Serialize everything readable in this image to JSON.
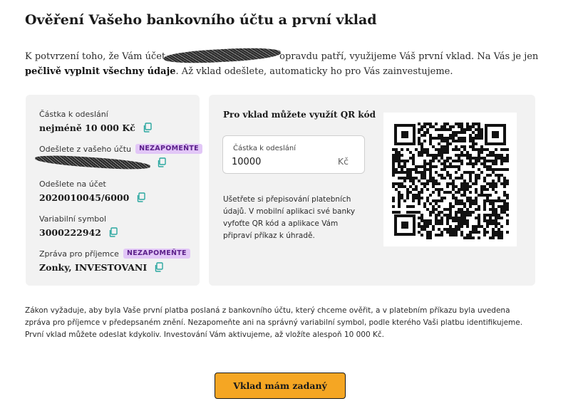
{
  "page": {
    "title": "Ověření Vašeho bankovního účtu a první vklad",
    "intro": {
      "part1": "K potvrzení toho, že Vám účet",
      "part2": "opravdu patří, využijeme Váš první vklad. Na Vás je jen",
      "bold": "pečlivě vyplnit všechny údaje",
      "part3": ". Až vklad odešlete, automaticky ho pro Vás zainvestujeme."
    }
  },
  "payment_details": {
    "amount": {
      "label": "Částka k odeslání",
      "value": "nejméně 10 000 Kč"
    },
    "from_account": {
      "label": "Odešlete z vašeho účtu",
      "badge": "NEZAPOMEŇTE"
    },
    "to_account": {
      "label": "Odešlete na účet",
      "value": "2020010045/6000"
    },
    "variable_symbol": {
      "label": "Variabilní symbol",
      "value": "3000222942"
    },
    "message": {
      "label": "Zpráva pro příjemce",
      "badge": "NEZAPOMEŇTE",
      "value": "Zonky, INVESTOVANI"
    }
  },
  "qr_section": {
    "heading": "Pro vklad můžete využít QR kód",
    "amount_field": {
      "label": "Částka k odeslání",
      "value": "10000",
      "unit": "Kč"
    },
    "help_text": "Ušetřete si přepisování platebních údajů. V mobilní aplikaci své banky vyfoťte QR kód a aplikace Vám připraví příkaz k úhradě."
  },
  "legal_text": "Zákon vyžaduje, aby byla Vaše první platba poslaná z bankovního účtu, který chceme ověřit, a v platebním příkazu byla uvedena zpráva pro příjemce v předepsaném znění. Nezapomeňte ani na správný variabilní symbol, podle kterého Vaši platbu identifikujeme. První vklad můžete odeslat kdykoliv. Investování Vám aktivujeme, až vložíte alespoň 10 000 Kč.",
  "cta": {
    "label": "Vklad mám zadaný"
  },
  "colors": {
    "accent": "#f5a623",
    "badge_bg": "#e2c7f7",
    "badge_text": "#5b1f8a",
    "panel_bg": "#f2f2f2"
  },
  "icons": {
    "copy": "copy-icon"
  }
}
